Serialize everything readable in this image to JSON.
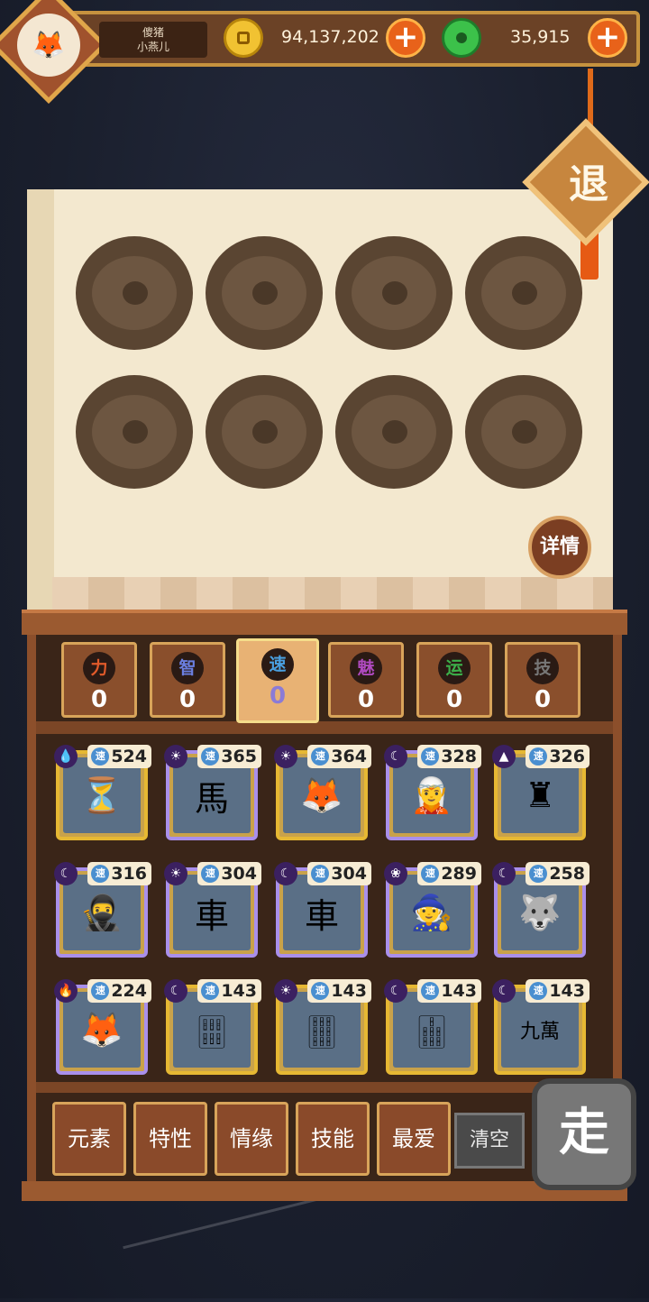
{
  "header": {
    "player_name_line1": "傻猪",
    "player_name_line2": "小燕儿",
    "gold_value": "94,137,202",
    "jade_value": "35,915"
  },
  "exit_label": "退",
  "detail_label": "详情",
  "stats": [
    {
      "label": "力",
      "value": "0",
      "icon_color": "#e05a2a"
    },
    {
      "label": "智",
      "value": "0",
      "icon_color": "#6b7fe0"
    },
    {
      "label": "速",
      "value": "0",
      "icon_color": "#4aa0e0"
    },
    {
      "label": "魅",
      "value": "0",
      "icon_color": "#b04ac0"
    },
    {
      "label": "运",
      "value": "0",
      "icon_color": "#3cb04a"
    },
    {
      "label": "技",
      "value": "0",
      "icon_color": "#777777"
    }
  ],
  "cards": [
    {
      "element": "water",
      "icon": "⏳",
      "speed_label": "速",
      "value": "524",
      "gold": true
    },
    {
      "element": "sun",
      "icon": "馬",
      "speed_label": "速",
      "value": "365",
      "gold": false
    },
    {
      "element": "sun",
      "icon": "🦊",
      "speed_label": "速",
      "value": "364",
      "gold": true
    },
    {
      "element": "moon",
      "icon": "🧝",
      "speed_label": "速",
      "value": "328",
      "gold": false
    },
    {
      "element": "earth",
      "icon": "♜",
      "speed_label": "速",
      "value": "326",
      "gold": true
    },
    {
      "element": "moon",
      "icon": "🥷",
      "speed_label": "速",
      "value": "316",
      "gold": false
    },
    {
      "element": "sun",
      "icon": "車",
      "speed_label": "速",
      "value": "304",
      "gold": false
    },
    {
      "element": "moon",
      "icon": "車",
      "speed_label": "速",
      "value": "304",
      "gold": false
    },
    {
      "element": "wood",
      "icon": "🧙",
      "speed_label": "速",
      "value": "289",
      "gold": false
    },
    {
      "element": "moon",
      "icon": "🐺",
      "speed_label": "速",
      "value": "258",
      "gold": false
    },
    {
      "element": "fire",
      "icon": "🦊",
      "speed_label": "速",
      "value": "224",
      "gold": false
    },
    {
      "element": "moon",
      "icon": "🀕",
      "speed_label": "速",
      "value": "143",
      "gold": true
    },
    {
      "element": "sun",
      "icon": "🀘",
      "speed_label": "速",
      "value": "143",
      "gold": true
    },
    {
      "element": "moon",
      "icon": "🀖",
      "speed_label": "速",
      "value": "143",
      "gold": true
    },
    {
      "element": "moon",
      "icon": "九萬",
      "speed_label": "速",
      "value": "143",
      "gold": true
    }
  ],
  "filter_buttons": [
    "元素",
    "特性",
    "情缘",
    "技能",
    "最爱"
  ],
  "clear_label": "清空",
  "go_label": "走"
}
